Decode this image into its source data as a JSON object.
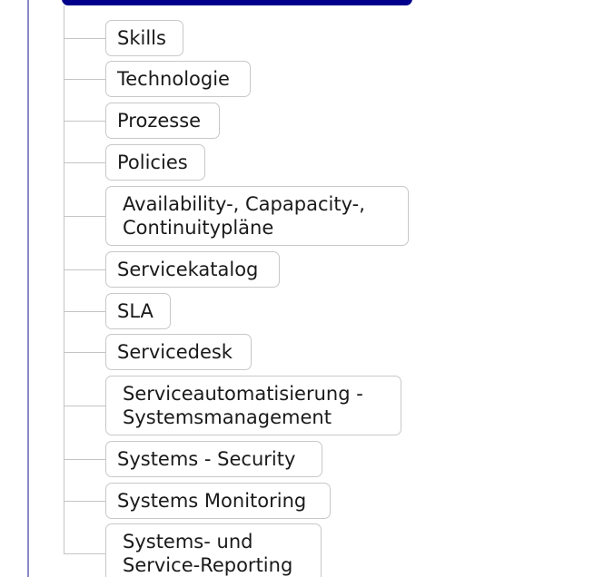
{
  "diagram": {
    "items": [
      {
        "lines": [
          "Skills"
        ]
      },
      {
        "lines": [
          "Technologie"
        ]
      },
      {
        "lines": [
          "Prozesse"
        ]
      },
      {
        "lines": [
          "Policies"
        ]
      },
      {
        "lines": [
          "Availability-, Capapacity-,",
          "Continuitypläne"
        ]
      },
      {
        "lines": [
          "Servicekatalog"
        ]
      },
      {
        "lines": [
          "SLA"
        ]
      },
      {
        "lines": [
          "Servicedesk"
        ]
      },
      {
        "lines": [
          "Serviceautomatisierung -",
          "Systemsmanagement"
        ]
      },
      {
        "lines": [
          "Systems - Security"
        ]
      },
      {
        "lines": [
          "Systems Monitoring"
        ]
      },
      {
        "lines": [
          "Systems- und",
          "Service-Reporting"
        ]
      }
    ]
  }
}
